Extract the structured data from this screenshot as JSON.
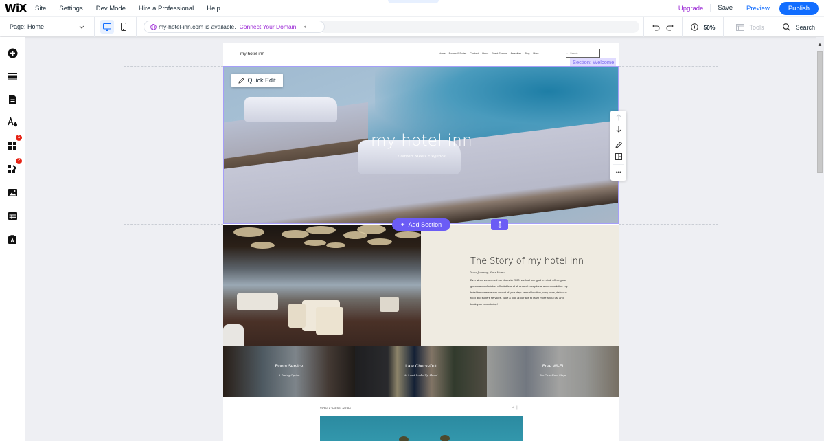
{
  "topbar": {
    "logo": "WiX",
    "menu": [
      "Site",
      "Settings",
      "Dev Mode",
      "Hire a Professional",
      "Help"
    ],
    "upgrade": "Upgrade",
    "save": "Save",
    "preview": "Preview",
    "publish": "Publish"
  },
  "toolbar": {
    "page_select": "Page: Home",
    "domain": {
      "url": "my-hotel-inn.com",
      "status": "is available.",
      "connect": "Connect Your Domain",
      "close": "×"
    },
    "zoom": "50%",
    "tools": "Tools",
    "search": "Search"
  },
  "leftbar": {
    "items": [
      {
        "icon": "add-icon"
      },
      {
        "icon": "sections-icon"
      },
      {
        "icon": "pages-icon"
      },
      {
        "icon": "theme-icon"
      },
      {
        "icon": "apps-icon",
        "badge": "1"
      },
      {
        "icon": "add-apps-icon",
        "badge": "2"
      },
      {
        "icon": "media-icon"
      },
      {
        "icon": "cms-icon"
      },
      {
        "icon": "portfolio-icon"
      }
    ]
  },
  "site": {
    "logo": "my hotel inn",
    "nav": [
      "Home",
      "Rooms & Suites",
      "Contact",
      "About",
      "Event Spaces",
      "Amenities",
      "Blog",
      "More"
    ],
    "search_placeholder": "Search...",
    "section_label": "Section: Welcome",
    "quick_edit": "Quick Edit",
    "hero_title": "my hotel inn",
    "hero_subtitle": "Comfort Meets Elegance",
    "add_section": "Add Section",
    "story": {
      "title": "The Story of my hotel inn",
      "subtitle": "Your Journey, Your Home",
      "body": "Ever since we opened our doors in 2000, we had one goal in mind: offering our guests a comfortable, affordable and all around exceptional accommodation. my hotel inn covers every aspect of your stay: central location, cosy beds, delicious food and superb services. Take a look at our site to learn more about us, and book your room today!"
    },
    "features": [
      {
        "title": "Room Service",
        "subtitle": "A Dining Option"
      },
      {
        "title": "Late Check-Out",
        "subtitle": "At Least Looks Up Ahead"
      },
      {
        "title": "Free Wi-Fi",
        "subtitle": "For Care-Free Stays"
      }
    ],
    "video_channel": "Video Channel Name"
  },
  "colors": {
    "accent": "#116dff",
    "editor_purple": "#6b5cf5",
    "upgrade_purple": "#9a27d5",
    "badge_red": "#e62214"
  }
}
